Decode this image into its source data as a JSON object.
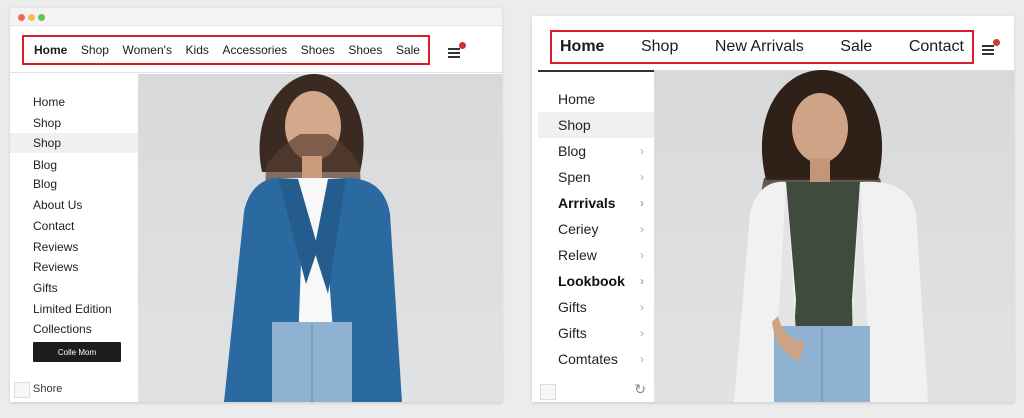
{
  "left_window": {
    "top_nav": [
      "Home",
      "Shop",
      "Women's",
      "Kids",
      "Accessories",
      "Shoes",
      "Shoes",
      "Sale"
    ],
    "sidebar_items": [
      "Home",
      "Shop",
      "Shop",
      "Blog",
      "Blog",
      "About Us",
      "Contact",
      "Reviews",
      "Reviews",
      "Gifts",
      "Limited Edition",
      "Collections"
    ],
    "active_index": 2,
    "collection_button": "Colle Mom",
    "footer_label": "Shore"
  },
  "right_window": {
    "top_nav": [
      "Home",
      "Shop",
      "New Arrivals",
      "Sale",
      "Contact"
    ],
    "sidebar_items": [
      {
        "label": "Home",
        "chevron": false,
        "bold": false
      },
      {
        "label": "Shop",
        "chevron": false,
        "bold": false,
        "active": true
      },
      {
        "label": "Blog",
        "chevron": true,
        "bold": false
      },
      {
        "label": "Spen",
        "chevron": true,
        "bold": false
      },
      {
        "label": "Arrrivals",
        "chevron": true,
        "bold": true
      },
      {
        "label": "Ceriey",
        "chevron": true,
        "bold": false
      },
      {
        "label": "Relew",
        "chevron": true,
        "bold": false
      },
      {
        "label": "Lookbook",
        "chevron": true,
        "bold": true
      },
      {
        "label": "Gifts",
        "chevron": true,
        "bold": false
      },
      {
        "label": "Gifts",
        "chevron": true,
        "bold": false
      },
      {
        "label": "Comtates",
        "chevron": true,
        "bold": false
      }
    ]
  },
  "icons": {
    "menu": "hamburger-icon",
    "notification": "notification-dot-icon",
    "chevron": "chevron-right-icon",
    "refresh": "refresh-icon"
  },
  "colors": {
    "highlight_border": "#d91e2a",
    "left_jacket": "#2a6aa0",
    "right_jacket": "#f1f1f1",
    "right_top": "#3e4b3d",
    "jeans": "#8fb2d3"
  }
}
